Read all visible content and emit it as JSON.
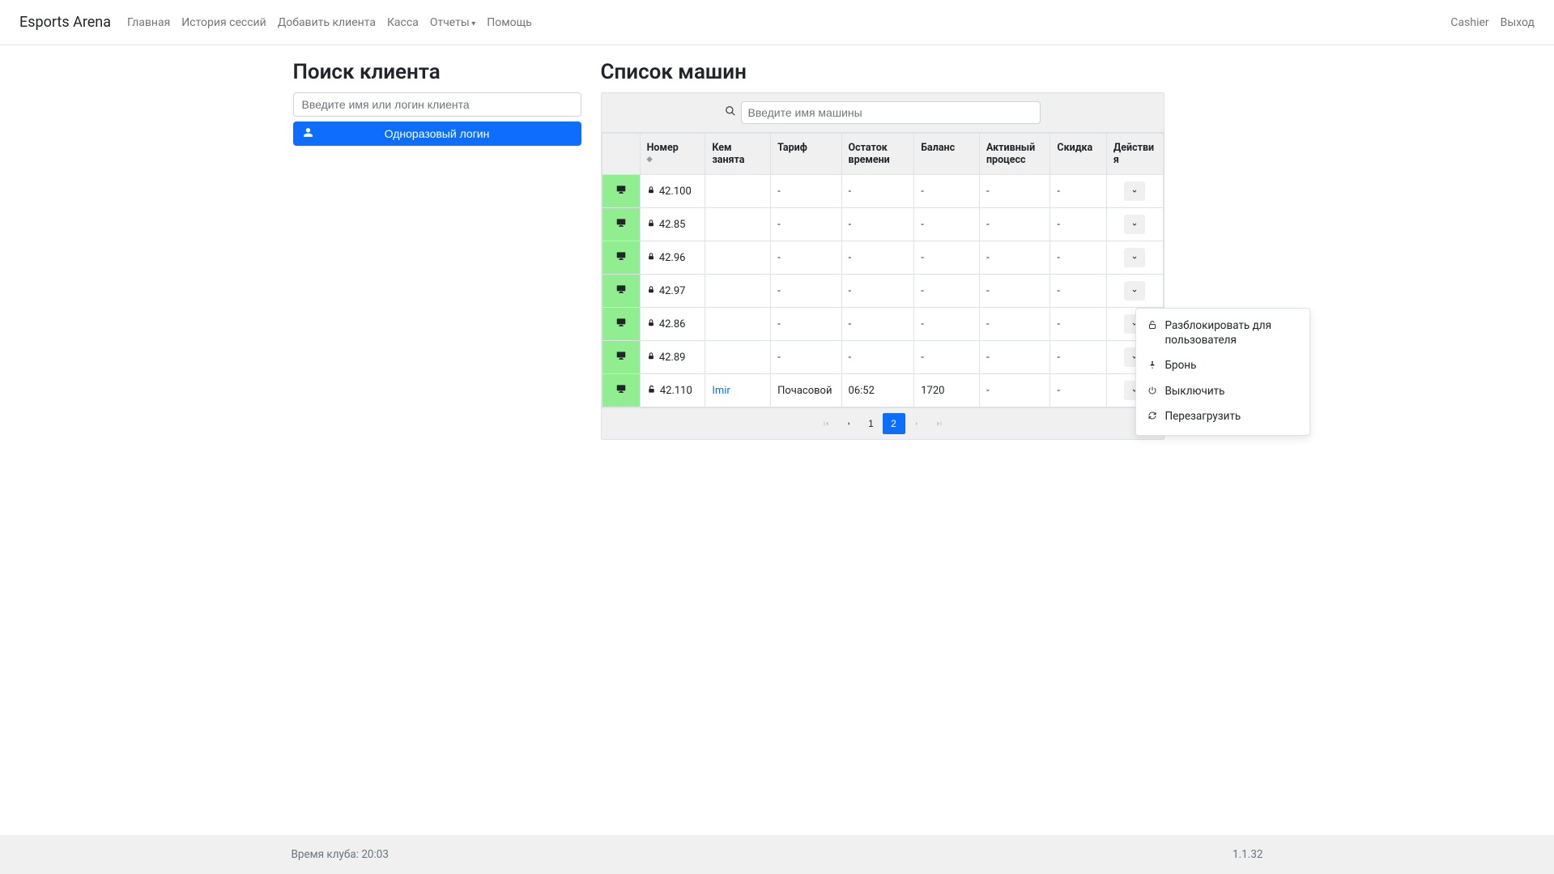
{
  "nav": {
    "brand": "Esports Arena",
    "items": [
      "Главная",
      "История сессий",
      "Добавить клиента",
      "Касса",
      "Отчеты",
      "Помощь"
    ],
    "right": {
      "user": "Cashier",
      "logout": "Выход"
    }
  },
  "client_search": {
    "title": "Поиск клиента",
    "placeholder": "Введите имя или логин клиента",
    "button": "Одноразовый логин"
  },
  "machines": {
    "title": "Список машин",
    "search_placeholder": "Введите имя машины",
    "columns": {
      "number": "Номер",
      "occupied_by": "Кем занята",
      "tariff": "Тариф",
      "time_remaining": "Остаток времени",
      "balance": "Баланс",
      "active_process": "Активный процесс",
      "discount": "Скидка",
      "actions": "Действия"
    },
    "rows": [
      {
        "locked": true,
        "number": "42.100",
        "occupied_by": "",
        "tariff": "-",
        "time_remaining": "-",
        "balance": "-",
        "active_process": "-",
        "discount": "-"
      },
      {
        "locked": true,
        "number": "42.85",
        "occupied_by": "",
        "tariff": "-",
        "time_remaining": "-",
        "balance": "-",
        "active_process": "-",
        "discount": "-"
      },
      {
        "locked": true,
        "number": "42.96",
        "occupied_by": "",
        "tariff": "-",
        "time_remaining": "-",
        "balance": "-",
        "active_process": "-",
        "discount": "-"
      },
      {
        "locked": true,
        "number": "42.97",
        "occupied_by": "",
        "tariff": "-",
        "time_remaining": "-",
        "balance": "-",
        "active_process": "-",
        "discount": "-"
      },
      {
        "locked": true,
        "number": "42.86",
        "occupied_by": "",
        "tariff": "-",
        "time_remaining": "-",
        "balance": "-",
        "active_process": "-",
        "discount": "-"
      },
      {
        "locked": true,
        "number": "42.89",
        "occupied_by": "",
        "tariff": "-",
        "time_remaining": "-",
        "balance": "-",
        "active_process": "-",
        "discount": "-"
      },
      {
        "locked": false,
        "number": "42.110",
        "occupied_by": "Imir",
        "tariff": "Почасовой",
        "time_remaining": "06:52",
        "balance": "1720",
        "active_process": "-",
        "discount": "-"
      }
    ],
    "actions_menu": {
      "unlock": "Разблокировать для пользователя",
      "reserve": "Бронь",
      "shutdown": "Выключить",
      "restart": "Перезагрузить"
    },
    "pagination": {
      "pages": [
        "1",
        "2"
      ],
      "active": "2"
    }
  },
  "footer": {
    "club_time_label": "Время клуба: ",
    "club_time": "20:03",
    "version": "1.1.32"
  }
}
